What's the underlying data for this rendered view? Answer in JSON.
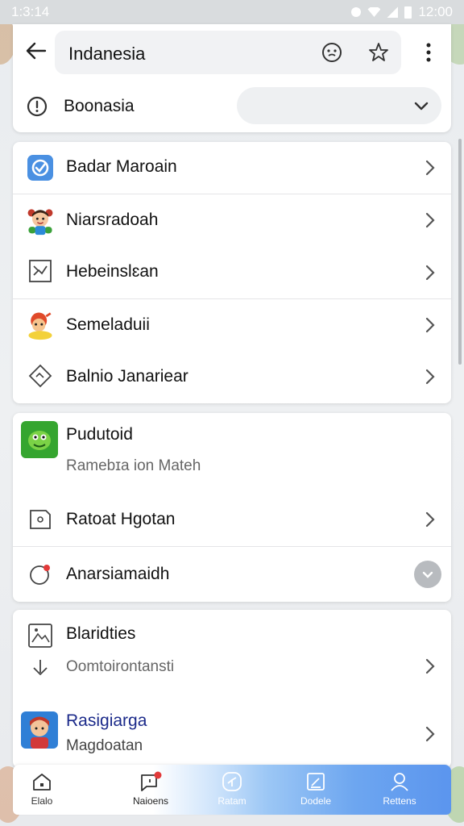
{
  "status_bar": {
    "time": "1:3:14",
    "clock": "12:00"
  },
  "header": {
    "title": "Indanesia",
    "region_label": "Boonasia",
    "region_value": ""
  },
  "sections": [
    {
      "rows": [
        {
          "label": "Badar Maroain",
          "icon": "shield-check-icon",
          "color": "#4a90e2"
        },
        {
          "label": "Niarsradoah",
          "icon": "character-avatar-icon"
        },
        {
          "label": "Hebeinslɛan",
          "icon": "chart-icon"
        }
      ]
    },
    {
      "rows": [
        {
          "label": "Semeladuii",
          "icon": "cartoon-avatar-icon"
        },
        {
          "label": "Balnio Janariear",
          "icon": "diamond-icon"
        }
      ]
    },
    {
      "rows": [
        {
          "label": "Pudutoid",
          "sub": "Ramebɪa ion Mateh",
          "icon": "green-monster-icon"
        },
        {
          "label": "Ratoat Hgotan",
          "icon": "message-icon"
        }
      ]
    },
    {
      "rows": [
        {
          "label": "Anarsiamaidh",
          "icon": "alert-circle-icon"
        }
      ]
    },
    {
      "rows": [
        {
          "label": "Blaridties",
          "sub": "Oomtoirontansti",
          "icon": "image-icon"
        },
        {
          "label": "Rasigiarga",
          "sub": "Magdoatan",
          "icon": "person-avatar-icon",
          "label_color": "#1b2a8a"
        }
      ]
    }
  ],
  "bottom_nav": [
    {
      "label": "Elalo",
      "icon": "home-icon"
    },
    {
      "label": "Naioens",
      "icon": "chat-icon"
    },
    {
      "label": "Ratam",
      "icon": "compass-icon"
    },
    {
      "label": "Dodele",
      "icon": "edit-icon"
    },
    {
      "label": "Rettens",
      "icon": "profile-icon"
    }
  ]
}
